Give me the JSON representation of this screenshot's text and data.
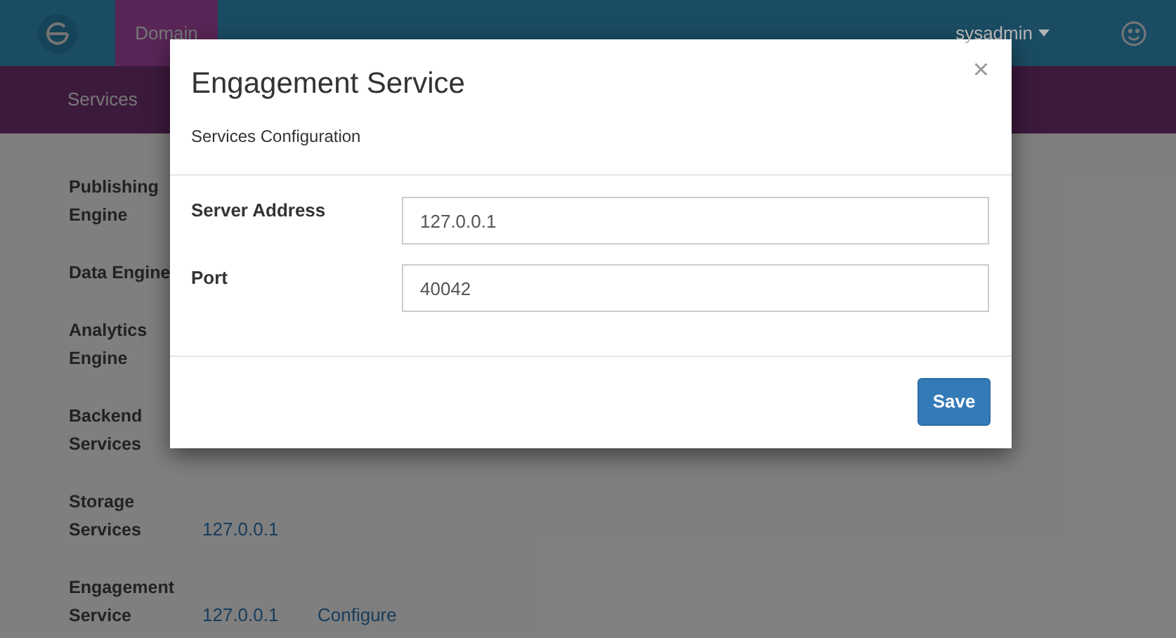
{
  "top_bar": {
    "tab": "Domain",
    "user": "sysadmin"
  },
  "nav": {
    "items": [
      "Services"
    ]
  },
  "services": [
    {
      "label": "Publishing Engine"
    },
    {
      "label": "Data Engine"
    },
    {
      "label": "Analytics Engine"
    },
    {
      "label": "Backend Services"
    },
    {
      "label": "Storage Services",
      "address": "127.0.0.1"
    },
    {
      "label": "Engagement Service",
      "address": "127.0.0.1",
      "action": "Configure"
    }
  ],
  "modal": {
    "title": "Engagement Service",
    "close": "×",
    "subtitle": "Services Configuration",
    "fields": [
      {
        "label": "Server Address",
        "value": "127.0.0.1"
      },
      {
        "label": "Port",
        "value": "40042"
      }
    ],
    "button": "Save"
  }
}
